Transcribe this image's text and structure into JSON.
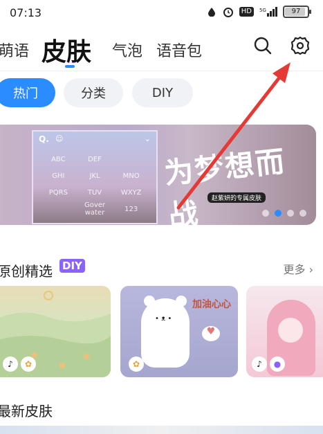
{
  "status_bar": {
    "time": "07:13",
    "signal": "5G",
    "hd": "HD",
    "battery": "97",
    "battery_level_percent": 97
  },
  "top_tabs": [
    {
      "label": "萌语",
      "active": false
    },
    {
      "label": "皮肤",
      "active": true
    },
    {
      "label": "气泡",
      "active": false
    },
    {
      "label": "语音包",
      "active": false
    }
  ],
  "header_icons": {
    "search": "search-icon",
    "settings": "gear-icon"
  },
  "chips": [
    {
      "label": "热门",
      "active": true
    },
    {
      "label": "分类",
      "active": false
    },
    {
      "label": "DIY",
      "active": false
    }
  ],
  "banner": {
    "preview_keys": [
      "ABC",
      "DEF",
      "",
      "GHI",
      "JKL",
      "MNO",
      "PQRS",
      "TUV",
      "WXYZ",
      "",
      "Gover water",
      "123"
    ],
    "art_text": "为梦想而战",
    "sub_text": "赵紫妍的专属皮肤",
    "dot_count": 4,
    "active_dot": 1
  },
  "colors": {
    "accent": "#2a8cff",
    "diy_badge": "#8a63ff"
  },
  "sections": {
    "original": {
      "title": "原创精选",
      "badge": "DIY",
      "more": "更多",
      "cards": [
        {
          "name": "cartoon-garden"
        },
        {
          "name": "bear"
        },
        {
          "name": "sakura-girl"
        }
      ],
      "card2_text": "加油心心"
    },
    "newest": {
      "title": "最新皮肤"
    }
  }
}
